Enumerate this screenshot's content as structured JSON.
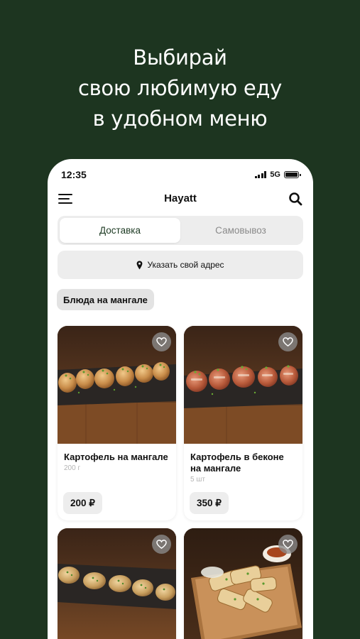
{
  "headline": [
    "Выбирай",
    "свою любимую еду",
    "в удобном меню"
  ],
  "status": {
    "time": "12:35",
    "network": "5G"
  },
  "app": {
    "title": "Hayatt"
  },
  "delivery_modes": [
    {
      "label": "Доставка",
      "active": true
    },
    {
      "label": "Самовывоз",
      "active": false
    }
  ],
  "address": {
    "label": "Указать свой адрес",
    "icon": "location-pin-icon"
  },
  "category": {
    "label": "Блюда на мангале"
  },
  "products": [
    {
      "name": "Картофель на мангале",
      "weight": "200 г",
      "price": "200 ₽",
      "image": "grilled-potatoes"
    },
    {
      "name": "Картофель в беконе на мангале",
      "weight": "5 шт",
      "price": "350 ₽",
      "image": "potatoes-in-bacon"
    },
    {
      "name": "",
      "weight": "",
      "price": "",
      "image": "stuffed-mushrooms"
    },
    {
      "name": "",
      "weight": "",
      "price": "",
      "image": "grilled-wraps-with-sauce"
    }
  ],
  "colors": {
    "background": "#1d3520",
    "accent": "#1c3a22",
    "panel": "#ededed"
  }
}
